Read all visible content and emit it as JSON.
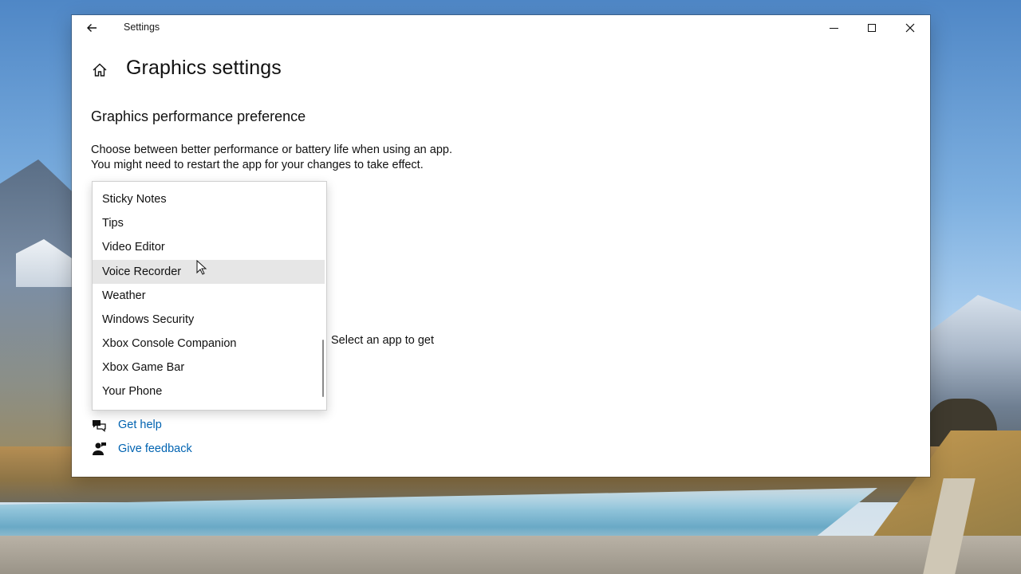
{
  "window": {
    "title": "Settings",
    "back_icon": "back-arrow-icon",
    "minimize_icon": "minimize-icon",
    "maximize_icon": "maximize-icon",
    "close_icon": "close-icon"
  },
  "page": {
    "home_icon": "home-icon",
    "title": "Graphics settings",
    "section_title": "Graphics performance preference",
    "description": "Choose between better performance or battery life when using an app. You might need to restart the app for your changes to take effect.",
    "partial_text": "Select an app to get"
  },
  "dropdown": {
    "items": [
      "Sticky Notes",
      "Tips",
      "Video Editor",
      "Voice Recorder",
      "Weather",
      "Windows Security",
      "Xbox Console Companion",
      "Xbox Game Bar",
      "Your Phone"
    ],
    "hovered_item": "Voice Recorder"
  },
  "help": {
    "get_help": "Get help",
    "get_help_icon": "chat-help-icon",
    "give_feedback": "Give feedback",
    "give_feedback_icon": "feedback-person-icon"
  },
  "colors": {
    "link": "#0063b1",
    "hover_bg": "#e6e6e6"
  }
}
